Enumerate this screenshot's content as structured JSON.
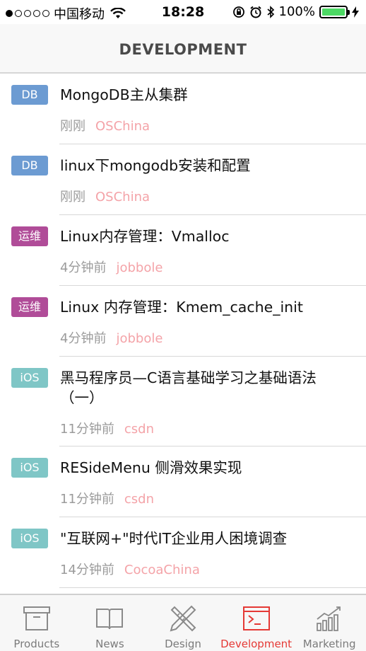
{
  "status_bar": {
    "carrier": "中国移动",
    "time": "18:28",
    "battery": "100%",
    "battery_level": 1.0,
    "signal_bars_filled": 1,
    "signal_bars_total": 5
  },
  "nav": {
    "title": "DEVELOPMENT"
  },
  "articles": [
    {
      "tag": "DB",
      "tag_color": "#6c9bd2",
      "title": "MongoDB主从集群",
      "time": "刚刚",
      "source": "OSChina"
    },
    {
      "tag": "DB",
      "tag_color": "#6c9bd2",
      "title": "linux下mongodb安装和配置",
      "time": "刚刚",
      "source": "OSChina"
    },
    {
      "tag": "运维",
      "tag_color": "#b04c98",
      "title": "Linux内存管理：Vmalloc",
      "time": "4分钟前",
      "source": "jobbole"
    },
    {
      "tag": "运维",
      "tag_color": "#b04c98",
      "title": "Linux 内存管理：Kmem_cache_init",
      "time": "4分钟前",
      "source": "jobbole"
    },
    {
      "tag": "iOS",
      "tag_color": "#7fc6c6",
      "title": "黑马程序员—C语言基础学习之基础语法（一）",
      "time": "11分钟前",
      "source": "csdn"
    },
    {
      "tag": "iOS",
      "tag_color": "#7fc6c6",
      "title": "RESideMenu 侧滑效果实现",
      "time": "11分钟前",
      "source": "csdn"
    },
    {
      "tag": "iOS",
      "tag_color": "#7fc6c6",
      "title": "\"互联网+\"时代IT企业用人困境调查",
      "time": "14分钟前",
      "source": "CocoaChina"
    }
  ],
  "tabs": [
    {
      "label": "Products",
      "icon": "box-icon",
      "active": false
    },
    {
      "label": "News",
      "icon": "book-icon",
      "active": false
    },
    {
      "label": "Design",
      "icon": "ruler-pencil-icon",
      "active": false
    },
    {
      "label": "Development",
      "icon": "terminal-icon",
      "active": true
    },
    {
      "label": "Marketing",
      "icon": "chart-icon",
      "active": false
    }
  ],
  "colors": {
    "accent": "#e53935",
    "source_text": "#f4a3a8",
    "meta_text": "#9b9b9b"
  }
}
